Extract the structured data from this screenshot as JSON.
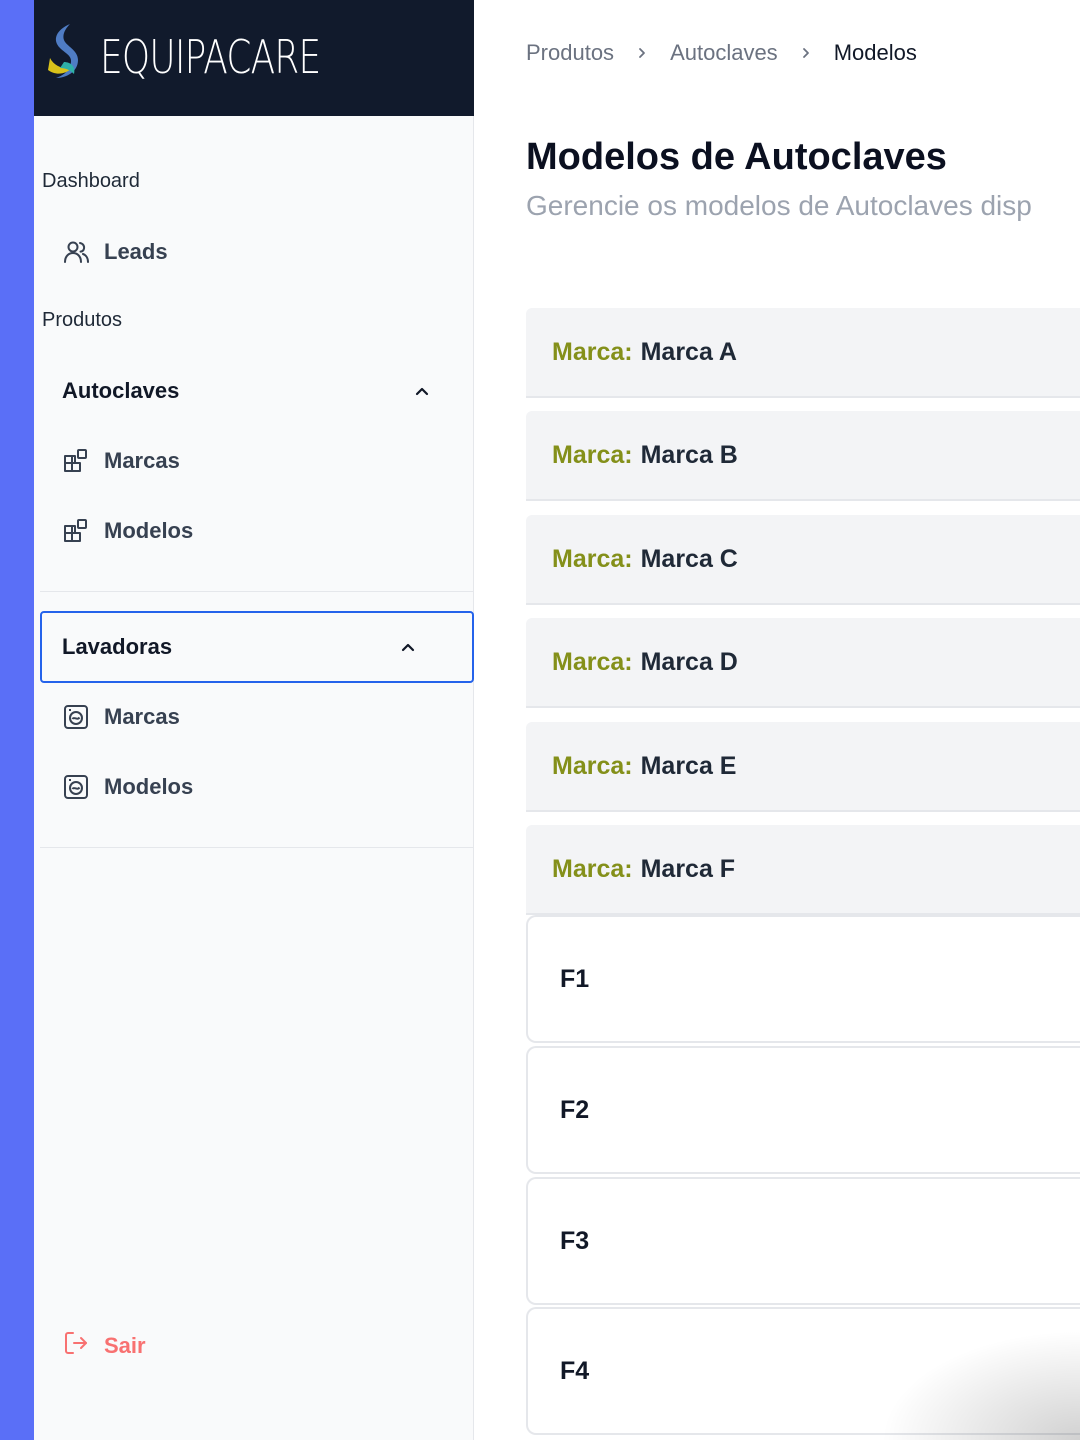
{
  "app": {
    "brand_name": "EQUIPACARE"
  },
  "sidebar": {
    "dashboard_title": "Dashboard",
    "leads_label": "Leads",
    "produtos_title": "Produtos",
    "groups": [
      {
        "label": "Autoclaves",
        "items": [
          {
            "label": "Marcas"
          },
          {
            "label": "Modelos"
          }
        ]
      },
      {
        "label": "Lavadoras",
        "items": [
          {
            "label": "Marcas"
          },
          {
            "label": "Modelos"
          }
        ]
      }
    ],
    "logout_label": "Sair"
  },
  "breadcrumb": [
    "Produtos",
    "Autoclaves",
    "Modelos"
  ],
  "main": {
    "title": "Modelos de Autoclaves",
    "subtitle": "Gerencie os modelos de Autoclaves disp",
    "brand_prefix": "Marca:",
    "brands": [
      "Marca A",
      "Marca B",
      "Marca C",
      "Marca D",
      "Marca E",
      "Marca F"
    ],
    "models": [
      "F1",
      "F2",
      "F3",
      "F4"
    ]
  },
  "colors": {
    "accent_stripe": "#5a6ff7",
    "brand_bar": "#111a2c",
    "focus_ring": "#2563eb",
    "brand_label": "#84901a",
    "logout": "#f87171"
  }
}
